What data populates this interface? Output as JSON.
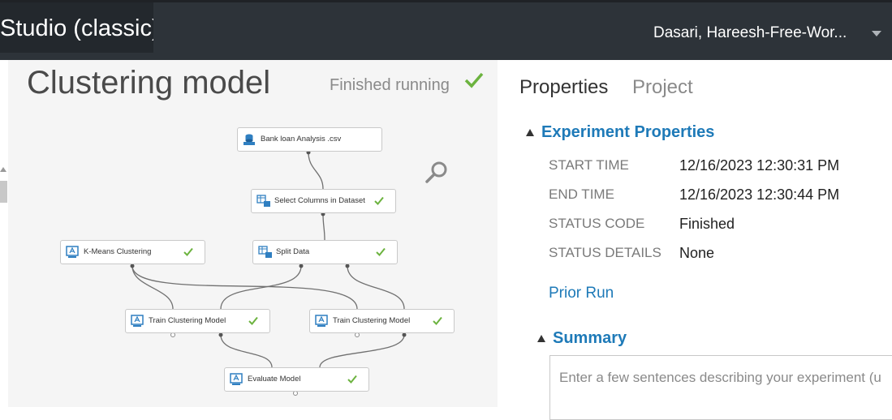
{
  "app": {
    "title": "Studio (classic)",
    "account_name": "Dasari, Hareesh-Free-Wor..."
  },
  "experiment": {
    "title": "Clustering model",
    "run_status": "Finished running"
  },
  "canvas": {
    "modules": [
      {
        "id": "bank",
        "label": "Bank loan Analysis .csv",
        "icon": "dataset-icon",
        "completed": false
      },
      {
        "id": "select",
        "label": "Select Columns in Dataset",
        "icon": "table-transform-icon",
        "completed": true
      },
      {
        "id": "kmeans",
        "label": "K-Means Clustering",
        "icon": "model-icon",
        "completed": true
      },
      {
        "id": "split",
        "label": "Split Data",
        "icon": "table-transform-icon",
        "completed": true
      },
      {
        "id": "train1",
        "label": "Train Clustering Model",
        "icon": "model-icon",
        "completed": true
      },
      {
        "id": "train2",
        "label": "Train Clustering Model",
        "icon": "model-icon",
        "completed": true
      },
      {
        "id": "evaluate",
        "label": "Evaluate Model",
        "icon": "model-icon",
        "completed": true
      }
    ]
  },
  "panel": {
    "tabs": [
      {
        "label": "Properties",
        "active": true
      },
      {
        "label": "Project",
        "active": false
      }
    ],
    "experiment_properties": {
      "heading": "Experiment Properties",
      "rows": [
        {
          "label": "START TIME",
          "value": "12/16/2023 12:30:31 PM"
        },
        {
          "label": "END TIME",
          "value": "12/16/2023 12:30:44 PM"
        },
        {
          "label": "STATUS CODE",
          "value": "Finished"
        },
        {
          "label": "STATUS DETAILS",
          "value": "None"
        }
      ]
    },
    "prior_run_link": "Prior Run",
    "summary": {
      "heading": "Summary",
      "placeholder": "Enter a few sentences describing your experiment (u"
    }
  },
  "colors": {
    "topbar": "#2d3339",
    "accent_link": "#1e7ab8",
    "success_check": "#6cb33f",
    "canvas_bg": "#f5f5f5"
  }
}
